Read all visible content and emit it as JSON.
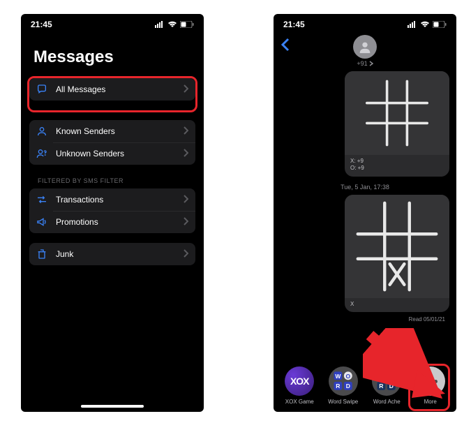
{
  "status": {
    "time": "21:45"
  },
  "left": {
    "title": "Messages",
    "filters": {
      "allMessages": "All Messages",
      "knownSenders": "Known Senders",
      "unknownSenders": "Unknown Senders"
    },
    "sectionHeader": "FILTERED BY SMS FILTER",
    "smsFilters": {
      "transactions": "Transactions",
      "promotions": "Promotions"
    },
    "junk": "Junk"
  },
  "right": {
    "contactPrefix": "+91",
    "bubble1": {
      "line1": "X: +9",
      "line2": "O: +9"
    },
    "timestamp": "Tue, 5 Jan, 17:38",
    "bubble2": {
      "line1": "X"
    },
    "readReceipt": "Read 05/01/21",
    "apps": {
      "xox": "XOX Game",
      "wordSwipe": "Word Swipe",
      "wordAche": "Word Ache",
      "more": "More"
    }
  }
}
